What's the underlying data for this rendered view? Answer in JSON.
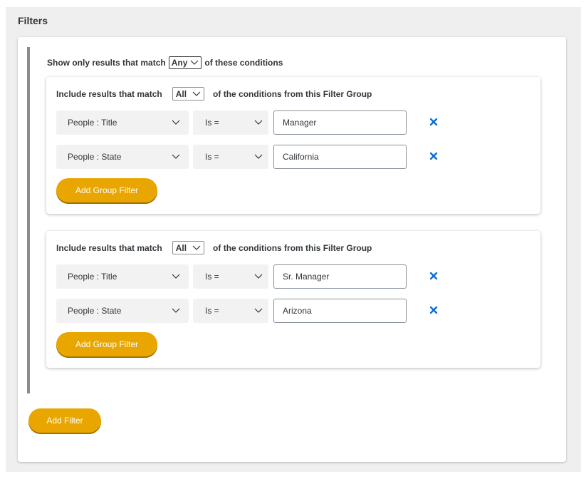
{
  "filters": {
    "title": "Filters",
    "match_prefix": "Show only results that match",
    "match_value": "Any",
    "match_suffix": "of these conditions",
    "groups": [
      {
        "head_prefix": "Include results that match",
        "match_value": "All",
        "head_suffix": "of the conditions from this Filter Group",
        "rows": [
          {
            "field": "People : Title",
            "operator": "Is =",
            "value": "Manager"
          },
          {
            "field": "People : State",
            "operator": "Is =",
            "value": "California"
          }
        ],
        "add_button": "Add Group Filter"
      },
      {
        "head_prefix": "Include results that match",
        "match_value": "All",
        "head_suffix": "of the conditions from this Filter Group",
        "rows": [
          {
            "field": "People : Title",
            "operator": "Is =",
            "value": "Sr. Manager"
          },
          {
            "field": "People : State",
            "operator": "Is =",
            "value": "Arizona"
          }
        ],
        "add_button": "Add Group Filter"
      }
    ],
    "add_filter_button": "Add Filter"
  },
  "icons": {
    "chevron": "chevron-down-icon",
    "remove": "close-icon"
  },
  "colors": {
    "accent": "#e9a600",
    "remove_icon": "#0a6ed1",
    "text": "#32363a",
    "panel_bg": "#efefef"
  }
}
